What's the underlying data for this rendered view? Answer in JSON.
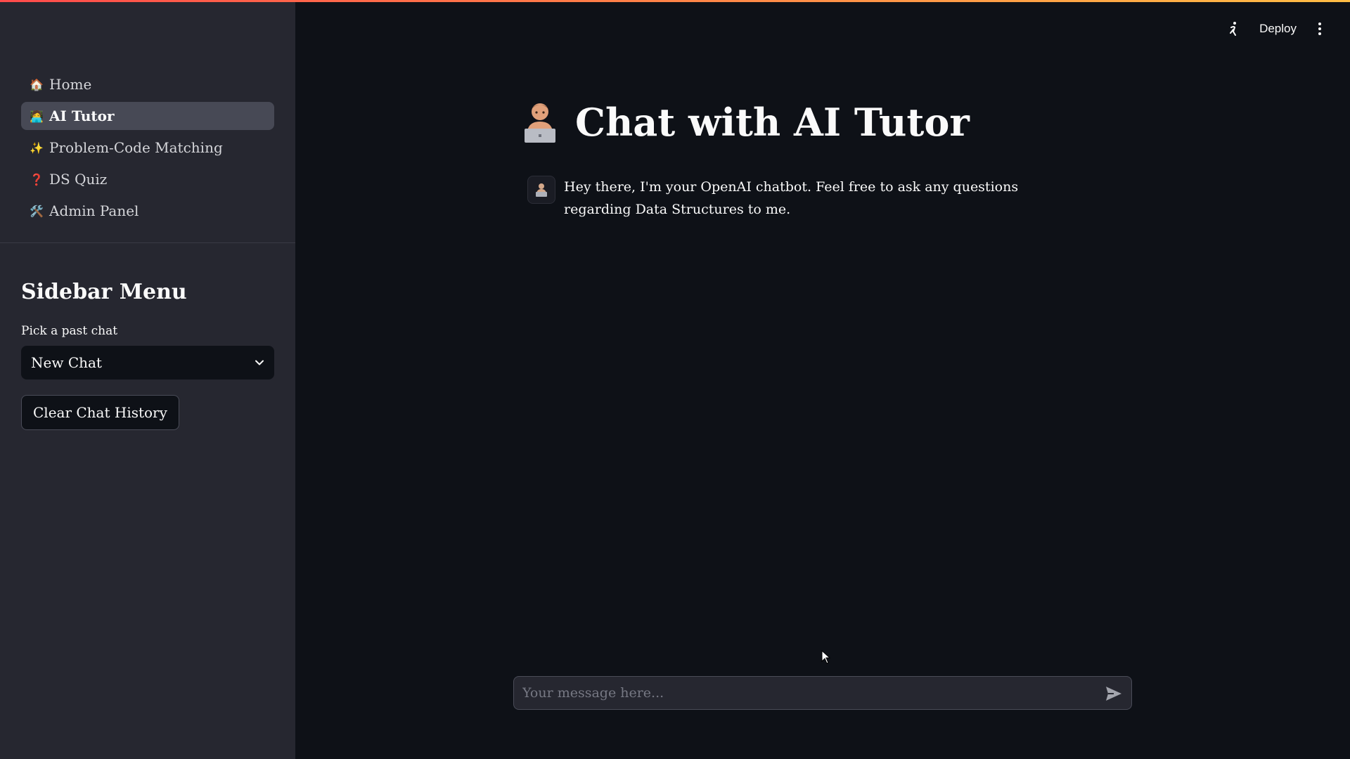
{
  "nav": {
    "items": [
      {
        "icon": "🏠",
        "icon_name": "house-icon",
        "label": "Home",
        "active": false
      },
      {
        "icon": "🧑‍💻",
        "icon_name": "technologist-icon",
        "label": "AI Tutor",
        "active": true
      },
      {
        "icon": "✨",
        "icon_name": "sparkles-icon",
        "label": "Problem-Code Matching",
        "active": false
      },
      {
        "icon": "❓",
        "icon_name": "question-icon",
        "label": "DS Quiz",
        "active": false
      },
      {
        "icon": "🛠️",
        "icon_name": "tools-icon",
        "label": "Admin Panel",
        "active": false
      }
    ]
  },
  "sidebar": {
    "title": "Sidebar Menu",
    "select_label": "Pick a past chat",
    "select_value": "New Chat",
    "clear_button": "Clear Chat History"
  },
  "header": {
    "deploy_label": "Deploy"
  },
  "main": {
    "title": "Chat with AI Tutor",
    "messages": [
      {
        "role": "assistant",
        "text": "Hey there, I'm your OpenAI chatbot. Feel free to ask any questions regarding Data Structures to me."
      }
    ]
  },
  "chat_input": {
    "placeholder": "Your message here...",
    "value": ""
  },
  "colors": {
    "accent_gradient_start": "#ff4b4b",
    "accent_gradient_end": "#ffbd45",
    "sidebar_bg": "#262730",
    "main_bg": "#0e1117"
  }
}
